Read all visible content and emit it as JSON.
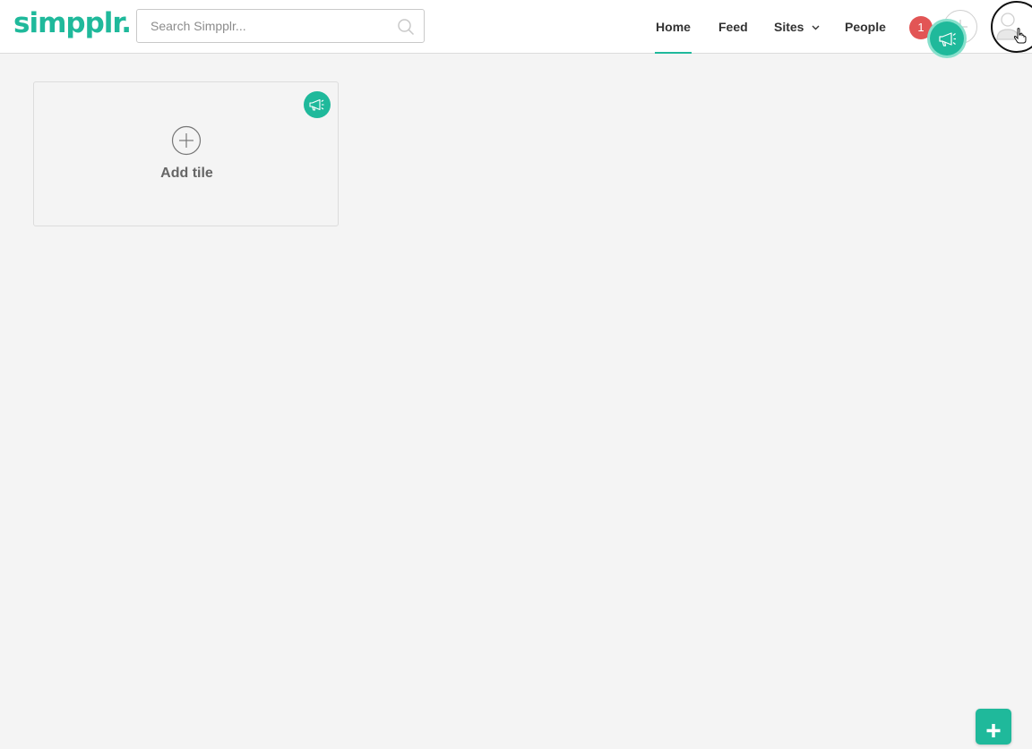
{
  "brand": {
    "logo_text": "simpplr.",
    "accent_color": "#1fb99b"
  },
  "search": {
    "placeholder": "Search Simpplr...",
    "value": ""
  },
  "nav": {
    "items": [
      {
        "label": "Home",
        "active": true
      },
      {
        "label": "Feed",
        "active": false
      },
      {
        "label": "Sites",
        "active": false,
        "has_dropdown": true
      },
      {
        "label": "People",
        "active": false
      }
    ]
  },
  "notifications": {
    "count": "1",
    "color": "#e25555"
  },
  "icons": {
    "search": "search-icon",
    "add": "plus-icon",
    "announcement": "megaphone-icon",
    "avatar": "user-icon",
    "cursor": "hand-pointer-icon",
    "dropdown": "chevron-down-icon"
  },
  "dashboard": {
    "tiles": [
      {
        "label": "Add tile",
        "icon": "plus-circle-icon"
      }
    ]
  },
  "fab": {
    "icon": "plus-icon",
    "color": "#1fb99b"
  }
}
